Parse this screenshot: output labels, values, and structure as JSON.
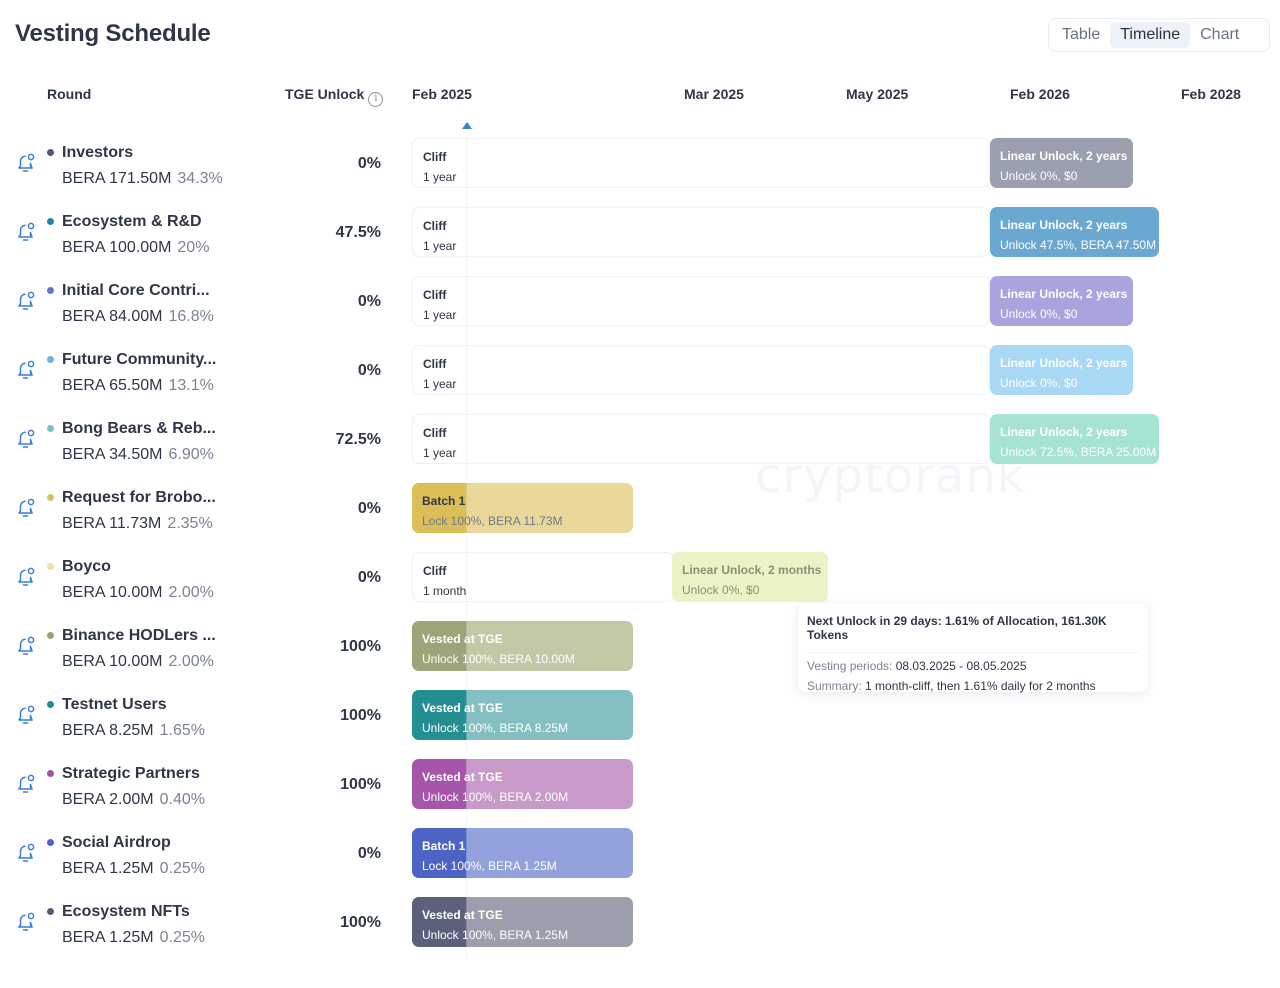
{
  "title": "Vesting Schedule",
  "view_switch": {
    "options": [
      "Table",
      "Timeline",
      "Chart"
    ],
    "selected": "Timeline"
  },
  "headers": {
    "round": "Round",
    "tge_unlock": "TGE Unlock",
    "info_icon": "info-icon"
  },
  "timeline_ticks": [
    "Feb 2025",
    "Mar 2025",
    "May 2025",
    "Feb 2026",
    "Feb 2028"
  ],
  "watermark": "cryptorank",
  "rounds": [
    {
      "name": "Investors",
      "amount": "BERA 171.50M",
      "share": "34.3%",
      "tge": "0%",
      "color": "#4f5872",
      "segments": [
        {
          "type": "cliff",
          "title": "Cliff",
          "detail": "1 year"
        },
        {
          "type": "linear",
          "title": "Linear Unlock, 2 years",
          "detail": "Unlock 0%, $0",
          "color": "#9ba0b0"
        }
      ]
    },
    {
      "name": "Ecosystem & R&D",
      "amount": "BERA 100.00M",
      "share": "20%",
      "tge": "47.5%",
      "color": "#1f86b0",
      "segments": [
        {
          "type": "cliff",
          "title": "Cliff",
          "detail": "1 year"
        },
        {
          "type": "linear",
          "title": "Linear Unlock, 2 years",
          "detail": "Unlock 47.5%, BERA 47.50M",
          "color": "#6aa8d2"
        }
      ]
    },
    {
      "name": "Initial Core Contri...",
      "amount": "BERA 84.00M",
      "share": "16.8%",
      "tge": "0%",
      "color": "#6675c0",
      "segments": [
        {
          "type": "cliff",
          "title": "Cliff",
          "detail": "1 year"
        },
        {
          "type": "linear",
          "title": "Linear Unlock, 2 years",
          "detail": "Unlock 0%, $0",
          "color": "#a9a3de"
        }
      ]
    },
    {
      "name": "Future Community...",
      "amount": "BERA 65.50M",
      "share": "13.1%",
      "tge": "0%",
      "color": "#6ab5de",
      "segments": [
        {
          "type": "cliff",
          "title": "Cliff",
          "detail": "1 year"
        },
        {
          "type": "linear",
          "title": "Linear Unlock, 2 years",
          "detail": "Unlock 0%, $0",
          "color": "#a8d8f3"
        }
      ]
    },
    {
      "name": "Bong Bears & Reb...",
      "amount": "BERA 34.50M",
      "share": "6.90%",
      "tge": "72.5%",
      "color": "#79c2bc",
      "segments": [
        {
          "type": "cliff",
          "title": "Cliff",
          "detail": "1 year"
        },
        {
          "type": "linear",
          "title": "Linear Unlock, 2 years",
          "detail": "Unlock 72.5%, BERA 25.00M",
          "color": "#a7e3d2"
        }
      ]
    },
    {
      "name": "Request for Brobo...",
      "amount": "BERA 11.73M",
      "share": "2.35%",
      "tge": "0%",
      "color": "#dcbf55",
      "segments": [
        {
          "type": "batch",
          "title": "Batch 1",
          "detail": "Lock 100%, BERA 11.73M",
          "color": "#ead79a",
          "dark": "#dcbe58",
          "text_color": "#2f3646",
          "detail_color": "#6d7a8e"
        }
      ]
    },
    {
      "name": "Boyco",
      "amount": "BERA 10.00M",
      "share": "2.00%",
      "tge": "0%",
      "color": "#ece2a6",
      "segments": [
        {
          "type": "cliff",
          "title": "Cliff",
          "detail": "1 month"
        },
        {
          "type": "linear",
          "title": "Linear Unlock, 2 months",
          "detail": "Unlock 0%, $0",
          "color": "#edf3c6",
          "text_color": "#8a8f7a"
        }
      ]
    },
    {
      "name": "Binance HODLers ...",
      "amount": "BERA 10.00M",
      "share": "2.00%",
      "tge": "100%",
      "color": "#98a26d",
      "segments": [
        {
          "type": "vested",
          "title": "Vested at TGE",
          "detail": "Unlock 100%, BERA 10.00M",
          "color": "#c5c8a6",
          "dark": "#9fa37a"
        }
      ]
    },
    {
      "name": "Testnet Users",
      "amount": "BERA 8.25M",
      "share": "1.65%",
      "tge": "100%",
      "color": "#1e8c8f",
      "segments": [
        {
          "type": "vested",
          "title": "Vested at TGE",
          "detail": "Unlock 100%, BERA 8.25M",
          "color": "#86bfc1",
          "dark": "#248e92"
        }
      ]
    },
    {
      "name": "Strategic Partners",
      "amount": "BERA 2.00M",
      "share": "0.40%",
      "tge": "100%",
      "color": "#a650ae",
      "segments": [
        {
          "type": "vested",
          "title": "Vested at TGE",
          "detail": "Unlock 100%, BERA 2.00M",
          "color": "#c89ac9",
          "dark": "#a556a9"
        }
      ]
    },
    {
      "name": "Social Airdrop",
      "amount": "BERA 1.25M",
      "share": "0.25%",
      "tge": "0%",
      "color": "#4b64c8",
      "segments": [
        {
          "type": "batch",
          "title": "Batch 1",
          "detail": "Lock 100%, BERA 1.25M",
          "color": "#93a2dc",
          "dark": "#4d64c4"
        }
      ]
    },
    {
      "name": "Ecosystem NFTs",
      "amount": "BERA 1.25M",
      "share": "0.25%",
      "tge": "100%",
      "color": "#535a72",
      "segments": [
        {
          "type": "vested",
          "title": "Vested at TGE",
          "detail": "Unlock 100%, BERA 1.25M",
          "color": "#9a9ead",
          "dark": "#5b617a"
        }
      ]
    }
  ],
  "tooltip": {
    "headline": "Next Unlock in 29 days: 1.61% of Allocation, 161.30K Tokens",
    "periods_label": "Vesting periods:",
    "periods_value": "08.03.2025 - 08.05.2025",
    "summary_label": "Summary:",
    "summary_value": "1 month-cliff, then 1.61% daily for 2 months"
  },
  "accent_color": "#3a7fd5"
}
